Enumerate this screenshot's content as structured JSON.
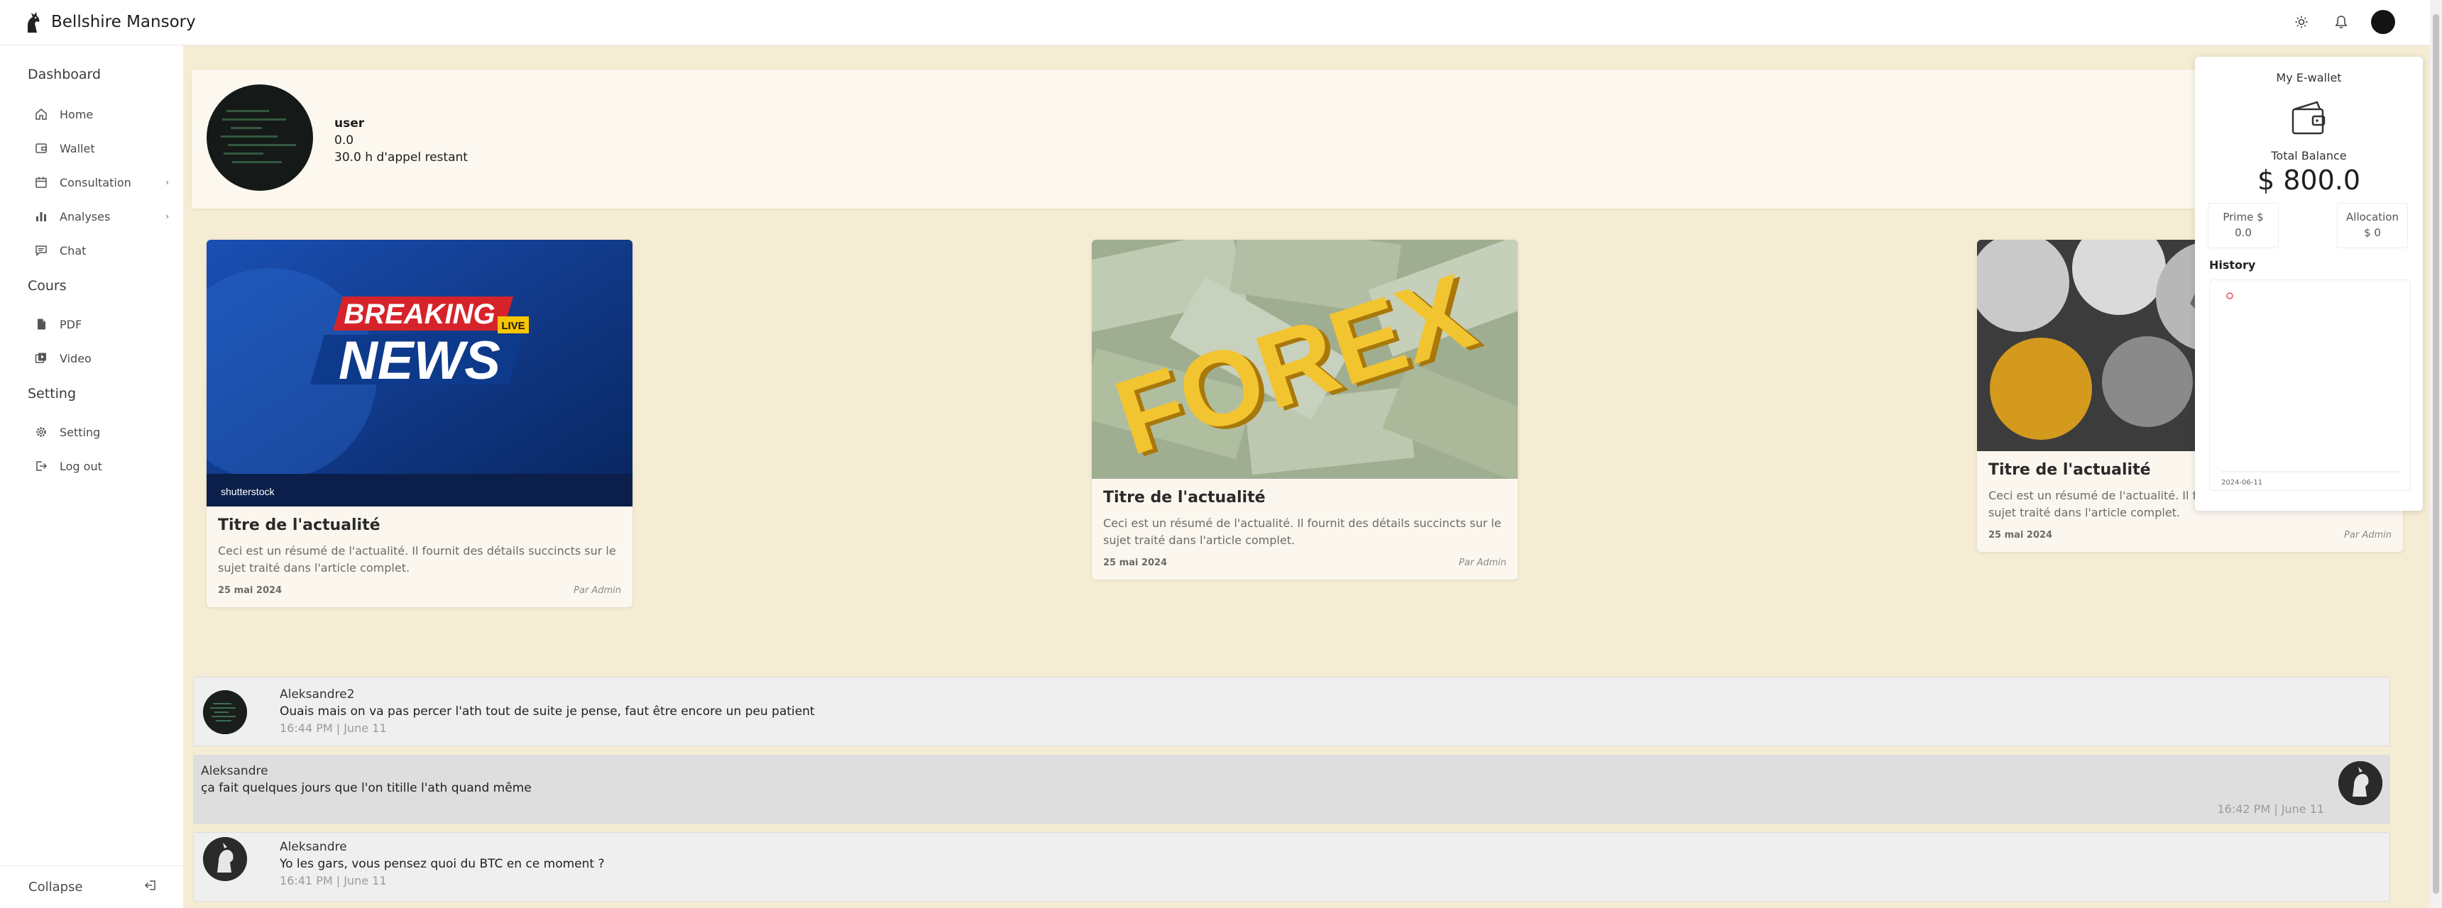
{
  "app": {
    "title": "Bellshire Mansory"
  },
  "sidebar": {
    "groups": [
      {
        "title": "Dashboard",
        "items": [
          {
            "label": "Home",
            "icon": "home-icon"
          },
          {
            "label": "Wallet",
            "icon": "wallet-icon"
          },
          {
            "label": "Consultation",
            "icon": "calendar-icon",
            "expandable": true
          },
          {
            "label": "Analyses",
            "icon": "bar-chart-icon",
            "expandable": true
          },
          {
            "label": "Chat",
            "icon": "chat-icon"
          }
        ]
      },
      {
        "title": "Cours",
        "items": [
          {
            "label": "PDF",
            "icon": "file-icon"
          },
          {
            "label": "Video",
            "icon": "video-icon"
          }
        ]
      },
      {
        "title": "Setting",
        "items": [
          {
            "label": "Setting",
            "icon": "gear-icon"
          },
          {
            "label": "Log out",
            "icon": "logout-icon"
          }
        ]
      }
    ],
    "collapse_label": "Collapse"
  },
  "profile": {
    "username": "user",
    "balance": "0.0",
    "hours": "30.0 h d'appel restant"
  },
  "news": [
    {
      "title": "Titre de l'actualité",
      "summary": "Ceci est un résumé de l'actualité. Il fournit des détails succincts sur le sujet traité dans l'article complet.",
      "date": "25 mai 2024",
      "author": "Par Admin",
      "image_text": [
        "BREAKING",
        "LIVE",
        "NEWS",
        "shutterstock"
      ]
    },
    {
      "title": "Titre de l'actualité",
      "summary": "Ceci est un résumé de l'actualité. Il fournit des détails succincts sur le sujet traité dans l'article complet.",
      "date": "25 mai 2024",
      "author": "Par Admin",
      "image_text": [
        "FOREX"
      ]
    },
    {
      "title": "Titre de l'actualité",
      "summary": "Ceci est un résumé de l'actualité. Il fournit des détails succincts sur le sujet traité dans l'article complet.",
      "date": "25 mai 2024",
      "author": "Par Admin",
      "image_text": []
    }
  ],
  "chat": [
    {
      "name": "Aleksandre2",
      "text": "Ouais mais on va pas percer l'ath tout de suite je pense, faut être encore un peu patient",
      "time": "16:44 PM | June 11",
      "side": "left"
    },
    {
      "name": "Aleksandre",
      "text": "ça fait quelques jours que l'on titille l'ath quand même",
      "time": "16:42 PM | June 11",
      "side": "right"
    },
    {
      "name": "Aleksandre",
      "text": "Yo les gars, vous pensez quoi du BTC en ce moment ?",
      "time": "16:41 PM | June 11",
      "side": "left"
    }
  ],
  "wallet": {
    "title": "My E-wallet",
    "total_label": "Total Balance",
    "total": "$ 800.0",
    "prime_label": "Prime $",
    "prime_value": "0.0",
    "allocation_label": "Allocation",
    "allocation_value": "$ 0",
    "history_label": "History",
    "chart_x_label": "2024-06-11"
  },
  "colors": {
    "background": "#f5ecd4",
    "card": "#fcf8ef",
    "accent_red": "#e8505b"
  }
}
